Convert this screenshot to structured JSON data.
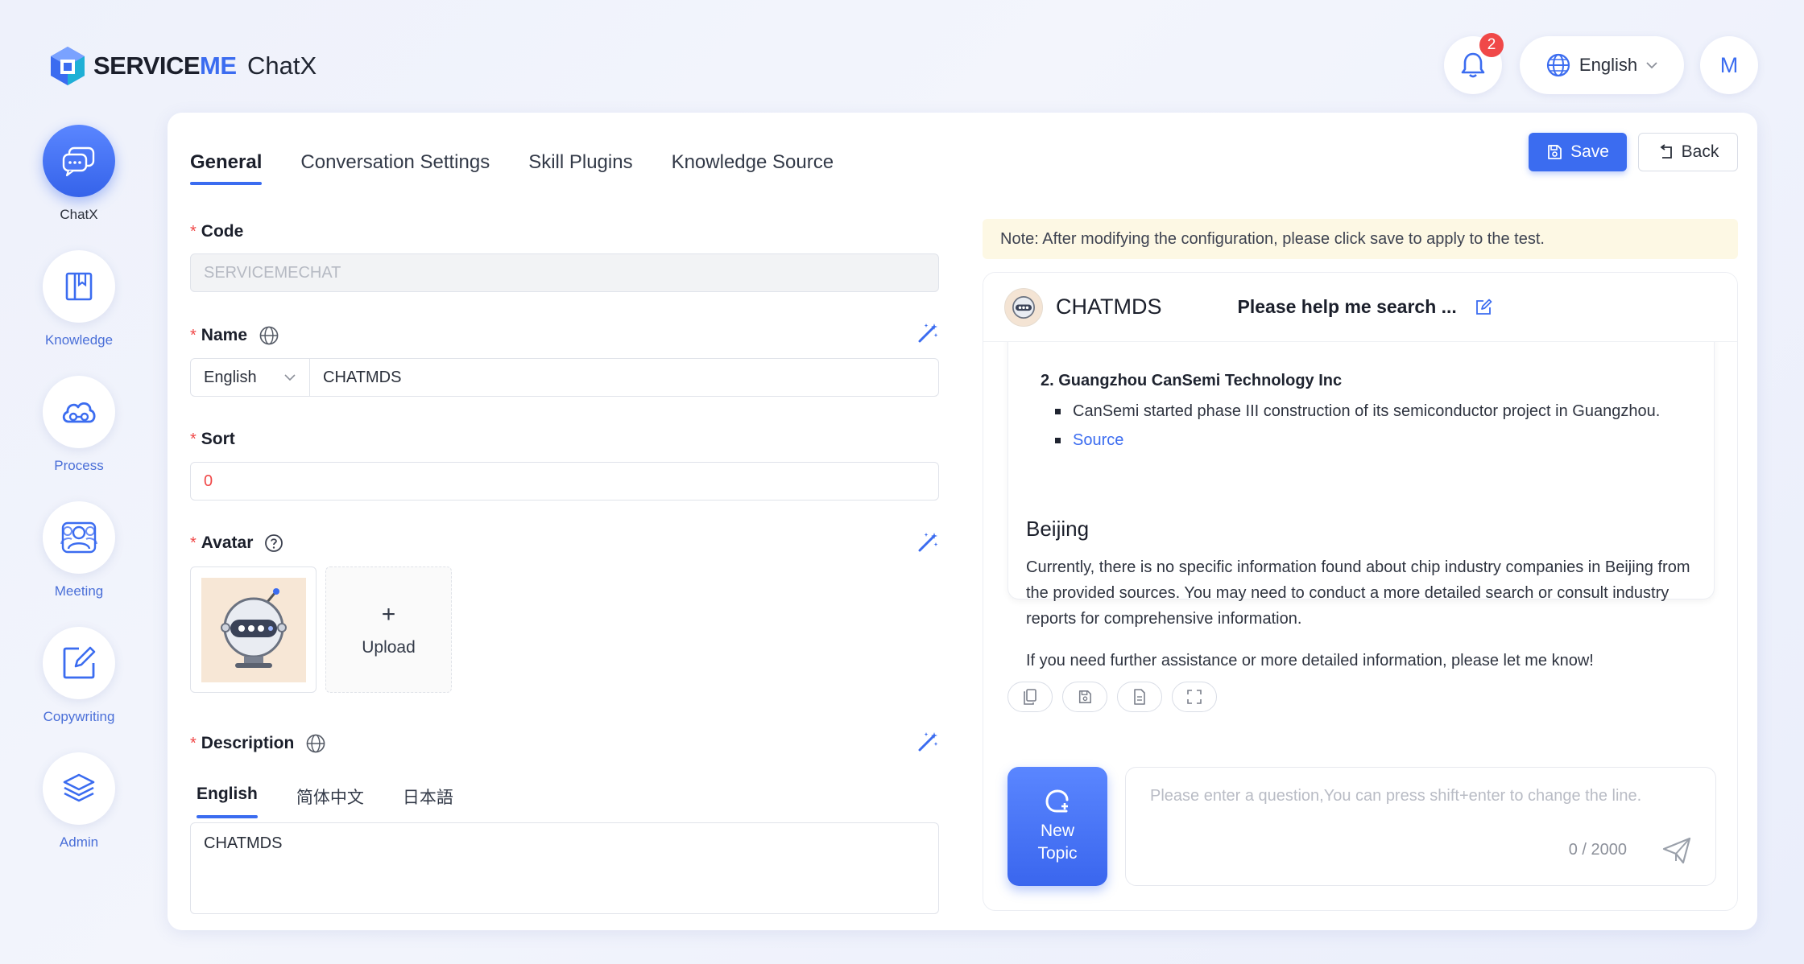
{
  "header": {
    "logo": {
      "part1": "SERVICE",
      "part2": "ME"
    },
    "app_title": "ChatX",
    "notifications": {
      "count": "2"
    },
    "language": "English",
    "avatar_initial": "M"
  },
  "sidebar": {
    "items": [
      {
        "label": "ChatX",
        "icon": "chat-icon",
        "active": true
      },
      {
        "label": "Knowledge",
        "icon": "book-icon",
        "active": false
      },
      {
        "label": "Process",
        "icon": "cloud-flow-icon",
        "active": false
      },
      {
        "label": "Meeting",
        "icon": "people-icon",
        "active": false
      },
      {
        "label": "Copywriting",
        "icon": "edit-icon",
        "active": false
      },
      {
        "label": "Admin",
        "icon": "layers-icon",
        "active": false
      }
    ]
  },
  "tabs": [
    "General",
    "Conversation Settings",
    "Skill Plugins",
    "Knowledge Source"
  ],
  "toolbar": {
    "save_label": "Save",
    "back_label": "Back"
  },
  "form": {
    "code": {
      "label": "Code",
      "value": "SERVICEMECHAT"
    },
    "name": {
      "label": "Name",
      "lang": "English",
      "value": "CHATMDS"
    },
    "sort": {
      "label": "Sort",
      "value": "0"
    },
    "avatar": {
      "label": "Avatar",
      "upload_plus": "+",
      "upload_label": "Upload"
    },
    "description": {
      "label": "Description",
      "tabs": [
        "English",
        "简体中文",
        "日本語"
      ],
      "value": "CHATMDS"
    }
  },
  "test_panel": {
    "note": "Note: After modifying the configuration, please click save to apply to the test.",
    "bot_name": "CHATMDS",
    "topic_title": "Please help me search ...",
    "message": {
      "cut_line": "2. Guangzhou CanSemi Technology Inc",
      "bullets": [
        "CanSemi started phase III construction of its semiconductor project in Guangzhou.",
        "Source"
      ],
      "heading": "Beijing",
      "paragraph1": "Currently, there is no specific information found about chip industry companies in Beijing from the provided sources. You may need to conduct a more detailed search or consult industry reports for comprehensive information.",
      "paragraph2": "If you need further assistance or more detailed information, please let me know!"
    },
    "new_topic": {
      "line1": "New",
      "line2": "Topic"
    },
    "input": {
      "placeholder": "Please enter a question,You can press shift+enter to change the line.",
      "counter": "0 / 2000"
    }
  },
  "colors": {
    "accent": "#3b6cf0",
    "required": "#f04848",
    "note_bg": "#fdf8e4"
  }
}
